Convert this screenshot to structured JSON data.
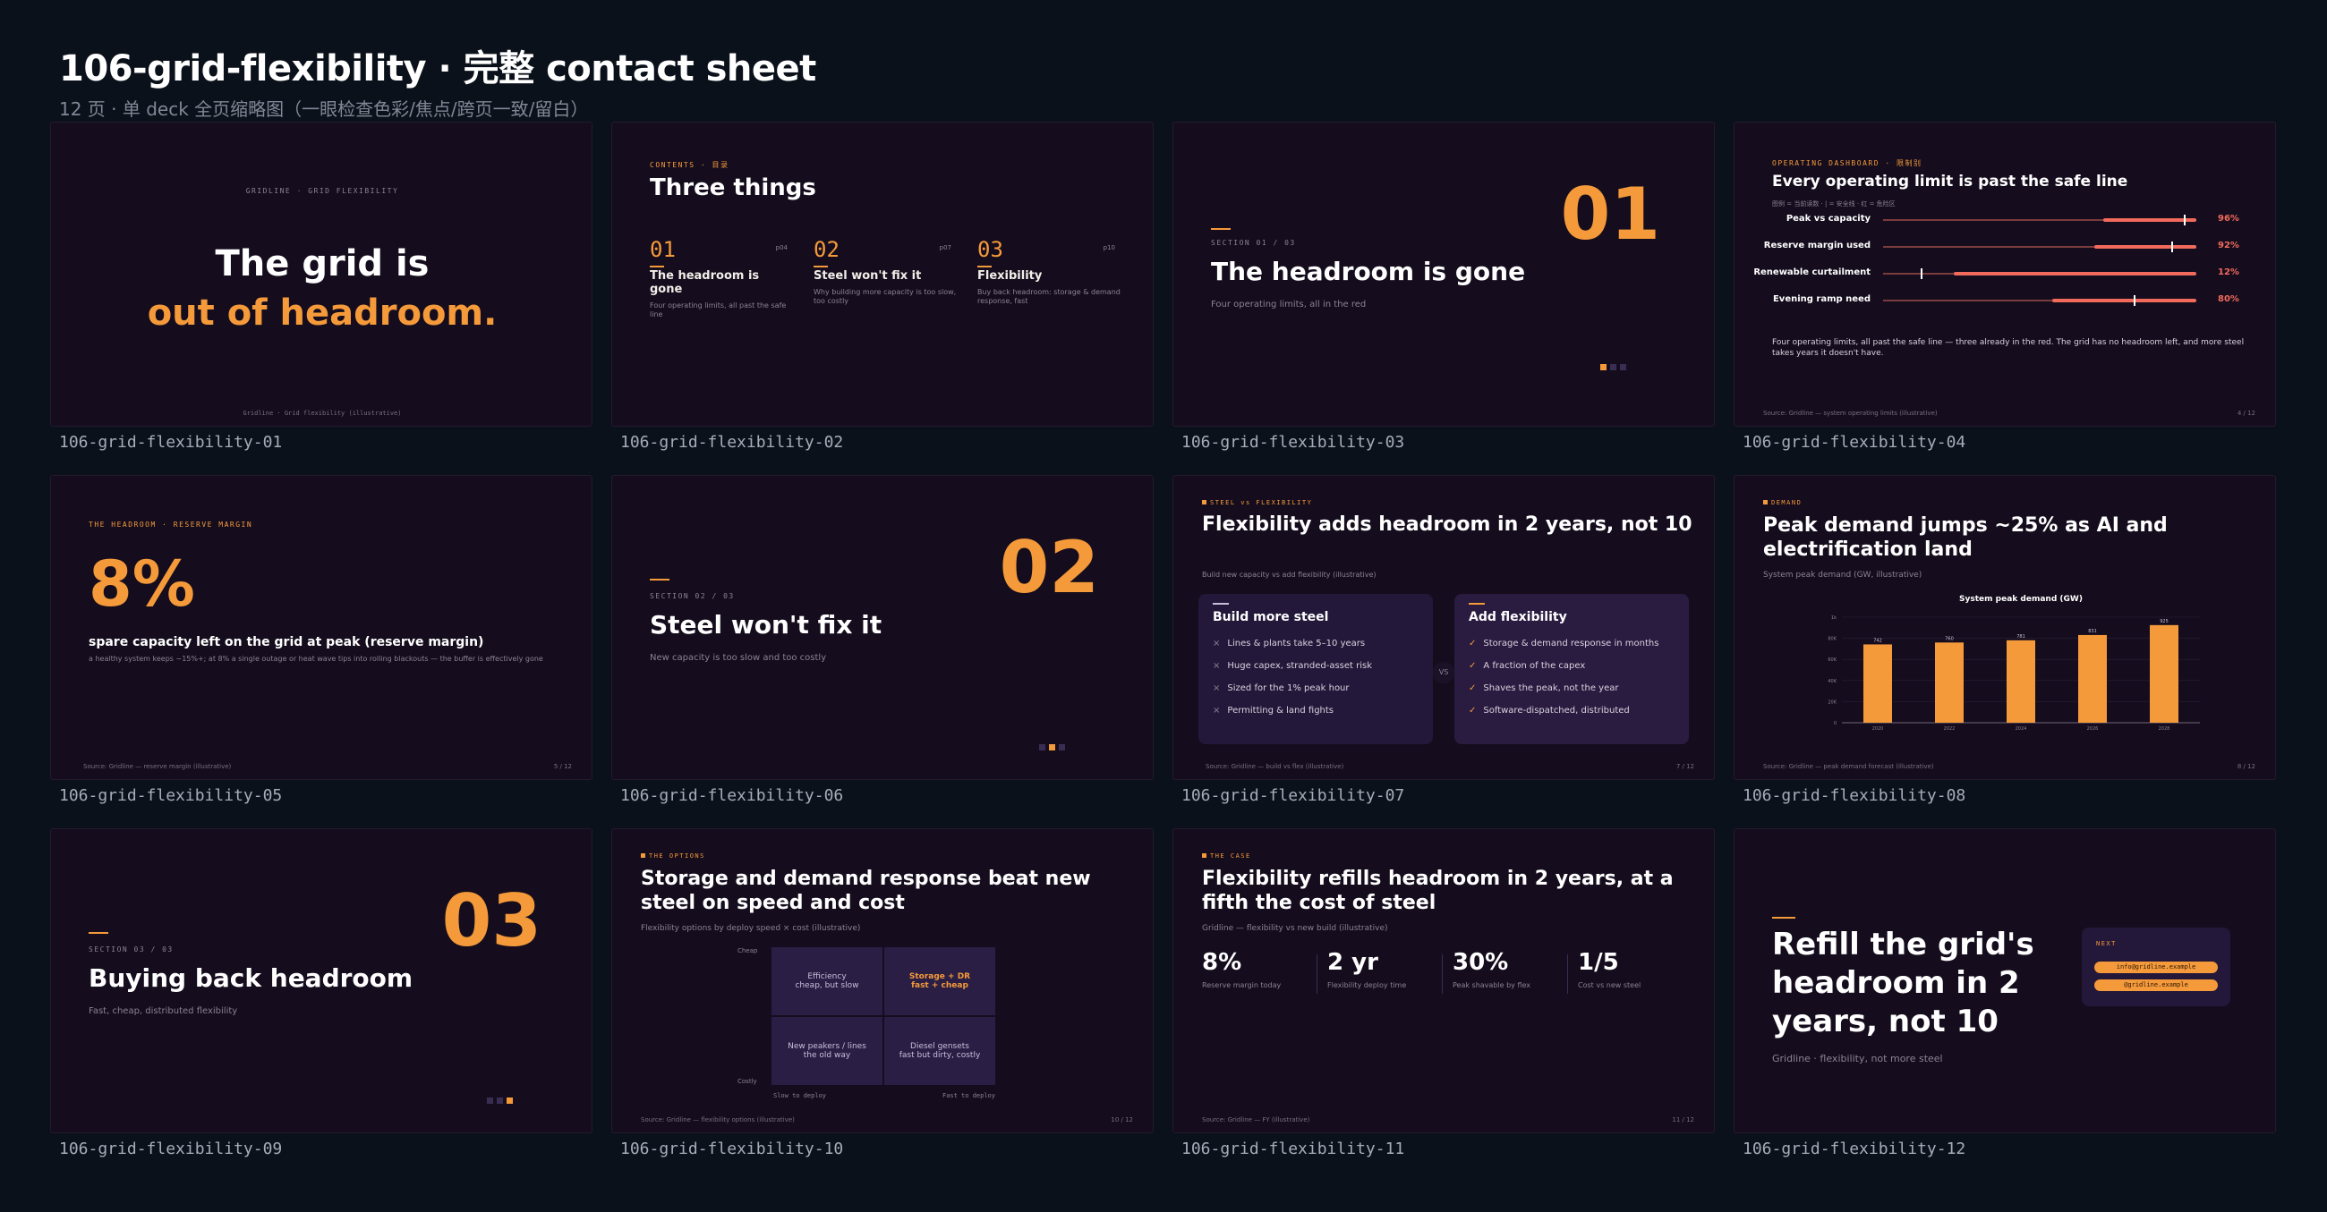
{
  "header": {
    "title": "106-grid-flexibility · 完整 contact sheet",
    "subtitle": "12 页 · 单 deck 全页缩略图（一眼检查色彩/焦点/跨页一致/留白）"
  },
  "captions": [
    "106-grid-flexibility-01",
    "106-grid-flexibility-02",
    "106-grid-flexibility-03",
    "106-grid-flexibility-04",
    "106-grid-flexibility-05",
    "106-grid-flexibility-06",
    "106-grid-flexibility-07",
    "106-grid-flexibility-08",
    "106-grid-flexibility-09",
    "106-grid-flexibility-10",
    "106-grid-flexibility-11",
    "106-grid-flexibility-12"
  ],
  "s1": {
    "kicker": "GRIDLINE · GRID FLEXIBILITY",
    "line1": "The grid is",
    "line2": "out of headroom.",
    "footer": "Gridline · Grid flexibility (illustrative)"
  },
  "s2": {
    "kicker": "CONTENTS · 目录",
    "title": "Three things",
    "items": [
      {
        "num": "01",
        "page": "p04",
        "title": "The headroom is gone",
        "desc": "Four operating limits, all past the safe line"
      },
      {
        "num": "02",
        "page": "p07",
        "title": "Steel won't fix it",
        "desc": "Why building more capacity is too slow, too costly"
      },
      {
        "num": "03",
        "page": "p10",
        "title": "Flexibility",
        "desc": "Buy back headroom: storage & demand response, fast"
      }
    ]
  },
  "s3": {
    "num": "01",
    "section": "SECTION 01 / 03",
    "title": "The headroom is gone",
    "sub": "Four operating limits, all in the red"
  },
  "s4": {
    "kicker": "OPERATING DASHBOARD · 限制别",
    "title": "Every operating limit is past the safe line",
    "legend": "图例 = 当前读数 · | = 安全线 · 红 = 危险区",
    "rows": [
      {
        "label": "Peak vs capacity",
        "value": "96%",
        "pct": 96,
        "safe": 78
      },
      {
        "label": "Reserve margin used",
        "value": "92%",
        "pct": 92,
        "safe": 75
      },
      {
        "label": "Renewable curtailment",
        "value": "12%",
        "pct": 12,
        "safe": 25
      },
      {
        "label": "Evening ramp need",
        "value": "80%",
        "pct": 80,
        "safe": 60
      }
    ],
    "note": "Four operating limits, all past the safe line — three already in the red. The grid has no headroom left, and more steel takes years it doesn't have.",
    "footer": "Source: Gridline — system operating limits (illustrative)",
    "page": "4 / 12"
  },
  "s5": {
    "kicker": "THE HEADROOM · RESERVE MARGIN",
    "big": "8%",
    "title": "spare capacity left on the grid at peak (reserve margin)",
    "desc": "a healthy system keeps ~15%+; at 8% a single outage or heat wave tips into rolling blackouts — the buffer is effectively gone",
    "footer": "Source: Gridline — reserve margin (illustrative)",
    "page": "5 / 12"
  },
  "s6": {
    "num": "02",
    "section": "SECTION 02 / 03",
    "title": "Steel won't fix it",
    "sub": "New capacity is too slow and too costly"
  },
  "s7": {
    "kicker": "STEEL vs FLEXIBILITY",
    "title": "Flexibility adds headroom in 2 years, not 10",
    "sub": "Build new capacity vs add flexibility (illustrative)",
    "vs": "VS",
    "left": {
      "title": "Build more steel",
      "items": [
        "Lines & plants take 5–10 years",
        "Huge capex, stranded-asset risk",
        "Sized for the 1% peak hour",
        "Permitting & land fights"
      ]
    },
    "right": {
      "title": "Add flexibility",
      "items": [
        "Storage & demand response in months",
        "A fraction of the capex",
        "Shaves the peak, not the year",
        "Software-dispatched, distributed"
      ]
    },
    "footer": "Source: Gridline — build vs flex (illustrative)",
    "page": "7 / 12"
  },
  "s8": {
    "kicker": "DEMAND",
    "title": "Peak demand jumps ~25% as AI and electrification land",
    "sub": "System peak demand (GW, illustrative)",
    "footer": "Source: Gridline — peak demand forecast (illustrative)",
    "page": "8 / 12"
  },
  "chart_data": {
    "type": "bar",
    "title": "System peak demand (GW)",
    "categories": [
      "2020",
      "2022",
      "2024",
      "2026",
      "2028"
    ],
    "values": [
      742,
      760,
      781,
      831,
      925
    ],
    "yticks": [
      "0",
      "20K",
      "40K",
      "60K",
      "80K",
      "1k"
    ],
    "ylim": [
      0,
      1000
    ],
    "xlabel": "",
    "ylabel": ""
  },
  "s9": {
    "num": "03",
    "section": "SECTION 03 / 03",
    "title": "Buying back headroom",
    "sub": "Fast, cheap, distributed flexibility"
  },
  "s10": {
    "kicker": "THE OPTIONS",
    "title": "Storage and demand response beat new steel on speed and cost",
    "sub": "Flexibility options by deploy speed × cost (illustrative)",
    "y_top": "Cheap",
    "y_bottom": "Costly",
    "x_left": "Slow to deploy",
    "x_right": "Fast to deploy",
    "q_tl": "Efficiency\ncheap, but slow",
    "q_tr": "Storage + DR\nfast + cheap",
    "q_bl": "New peakers / lines\nthe old way",
    "q_br": "Diesel gensets\nfast but dirty, costly",
    "footer": "Source: Gridline — flexibility options (illustrative)",
    "page": "10 / 12"
  },
  "s11": {
    "kicker": "THE CASE",
    "title": "Flexibility refills headroom in 2 years, at a fifth the cost of steel",
    "sub": "Gridline — flexibility vs new build (illustrative)",
    "stats": [
      {
        "n": "8%",
        "l": "Reserve margin today"
      },
      {
        "n": "2 yr",
        "l": "Flexibility deploy time"
      },
      {
        "n": "30%",
        "l": "Peak shavable by flex"
      },
      {
        "n": "1/5",
        "l": "Cost vs new steel"
      }
    ],
    "footer": "Source: Gridline — FY (illustrative)",
    "page": "11 / 12"
  },
  "s12": {
    "title": "Refill the grid's headroom in 2 years, not 10",
    "sub": "Gridline · flexibility, not more steel",
    "next": "NEXT",
    "pill1": "info@gridline.example",
    "pill2": "@gridline.example"
  },
  "colors": {
    "accent": "#f59a3a",
    "slide_bg": "#150d1d",
    "page_bg": "#0b111a",
    "danger": "#f26a5c",
    "card": "#24183a"
  }
}
